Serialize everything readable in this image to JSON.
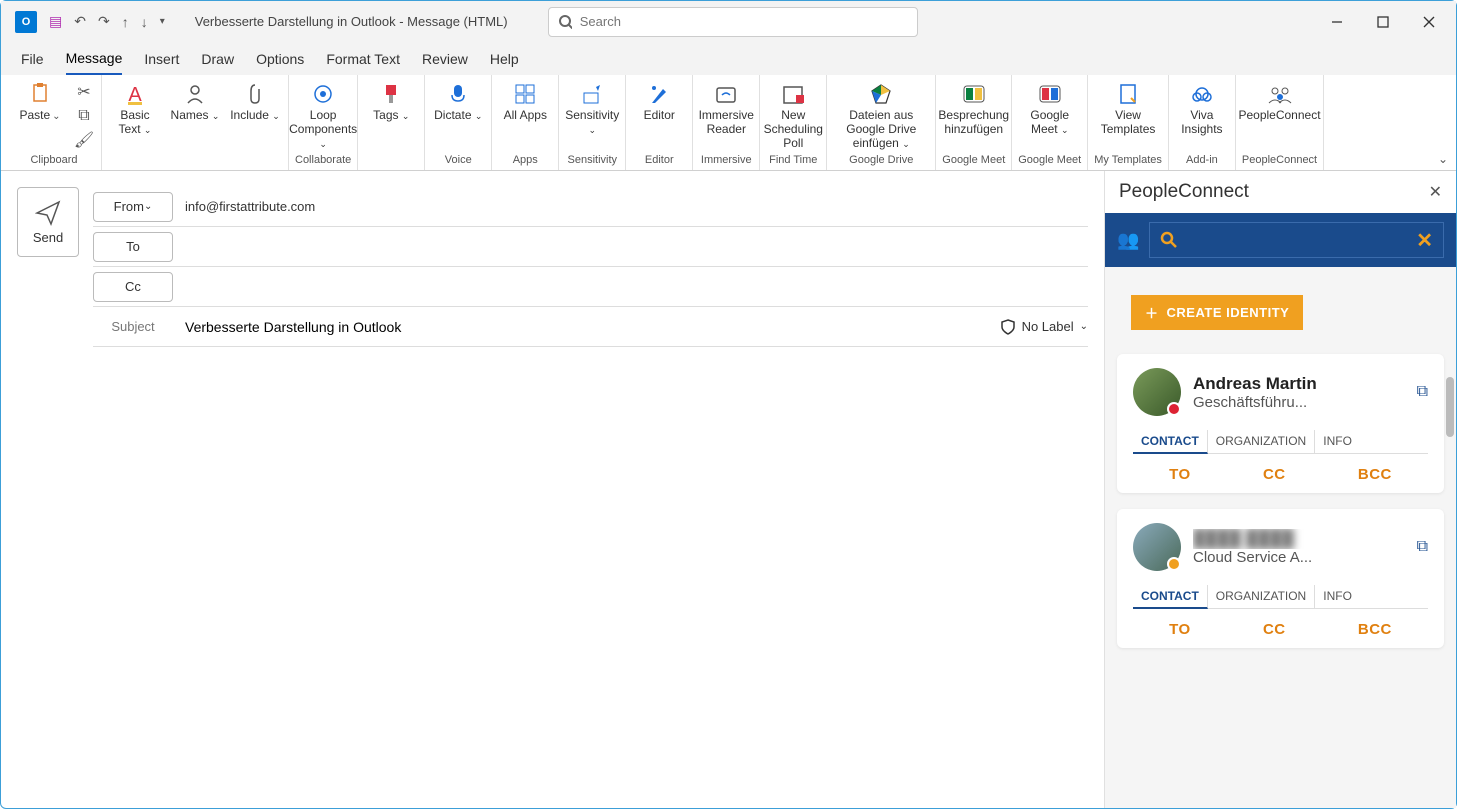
{
  "titlebar": {
    "title": "Verbesserte Darstellung in Outlook  -  Message (HTML)",
    "search_placeholder": "Search"
  },
  "tabs": [
    "File",
    "Message",
    "Insert",
    "Draw",
    "Options",
    "Format Text",
    "Review",
    "Help"
  ],
  "ribbon": {
    "groups": [
      {
        "label": "Clipboard",
        "items": [
          {
            "label": "Paste",
            "caret": true
          }
        ]
      },
      {
        "label": "",
        "items": [
          {
            "label": "Basic Text",
            "caret": true
          },
          {
            "label": "Names",
            "caret": true
          },
          {
            "label": "Include",
            "caret": true
          }
        ]
      },
      {
        "label": "Collaborate",
        "items": [
          {
            "label": "Loop Components",
            "caret": true
          }
        ]
      },
      {
        "label": "",
        "items": [
          {
            "label": "Tags",
            "caret": true
          }
        ]
      },
      {
        "label": "Voice",
        "items": [
          {
            "label": "Dictate",
            "caret": true
          }
        ]
      },
      {
        "label": "Apps",
        "items": [
          {
            "label": "All Apps"
          }
        ]
      },
      {
        "label": "Sensitivity",
        "items": [
          {
            "label": "Sensitivity",
            "caret": true
          }
        ]
      },
      {
        "label": "Editor",
        "items": [
          {
            "label": "Editor"
          }
        ]
      },
      {
        "label": "Immersive",
        "items": [
          {
            "label": "Immersive Reader"
          }
        ]
      },
      {
        "label": "Find Time",
        "items": [
          {
            "label": "New Scheduling Poll"
          }
        ]
      },
      {
        "label": "Google Drive",
        "items": [
          {
            "label": "Dateien aus Google Drive einfügen",
            "caret": true,
            "wide": true
          }
        ]
      },
      {
        "label": "Google Meet",
        "items": [
          {
            "label": "Besprechung hinzufügen"
          }
        ]
      },
      {
        "label": "Google Meet",
        "items": [
          {
            "label": "Google Meet",
            "caret": true
          }
        ]
      },
      {
        "label": "My Templates",
        "items": [
          {
            "label": "View Templates"
          }
        ]
      },
      {
        "label": "Add-in",
        "items": [
          {
            "label": "Viva Insights"
          }
        ]
      },
      {
        "label": "PeopleConnect",
        "items": [
          {
            "label": "PeopleConnect"
          }
        ]
      }
    ]
  },
  "compose": {
    "send": "Send",
    "from_label": "From",
    "from_value": "info@firstattribute.com",
    "to_label": "To",
    "cc_label": "Cc",
    "subject_label": "Subject",
    "subject_value": "Verbesserte Darstellung in Outlook",
    "nolabel": "No Label"
  },
  "panel": {
    "title": "PeopleConnect",
    "create": "CREATE IDENTITY",
    "cards": [
      {
        "name": "Andreas Martin",
        "role": "Geschäftsführu...",
        "presence": "red",
        "tabs": [
          "CONTACT",
          "ORGANIZATION",
          "INFO"
        ],
        "actions": [
          "TO",
          "CC",
          "BCC"
        ]
      },
      {
        "name": "████ ████",
        "role": "Cloud Service A...",
        "presence": "yellow",
        "blurred": true,
        "tabs": [
          "CONTACT",
          "ORGANIZATION",
          "INFO"
        ],
        "actions": [
          "TO",
          "CC",
          "BCC"
        ]
      }
    ]
  }
}
